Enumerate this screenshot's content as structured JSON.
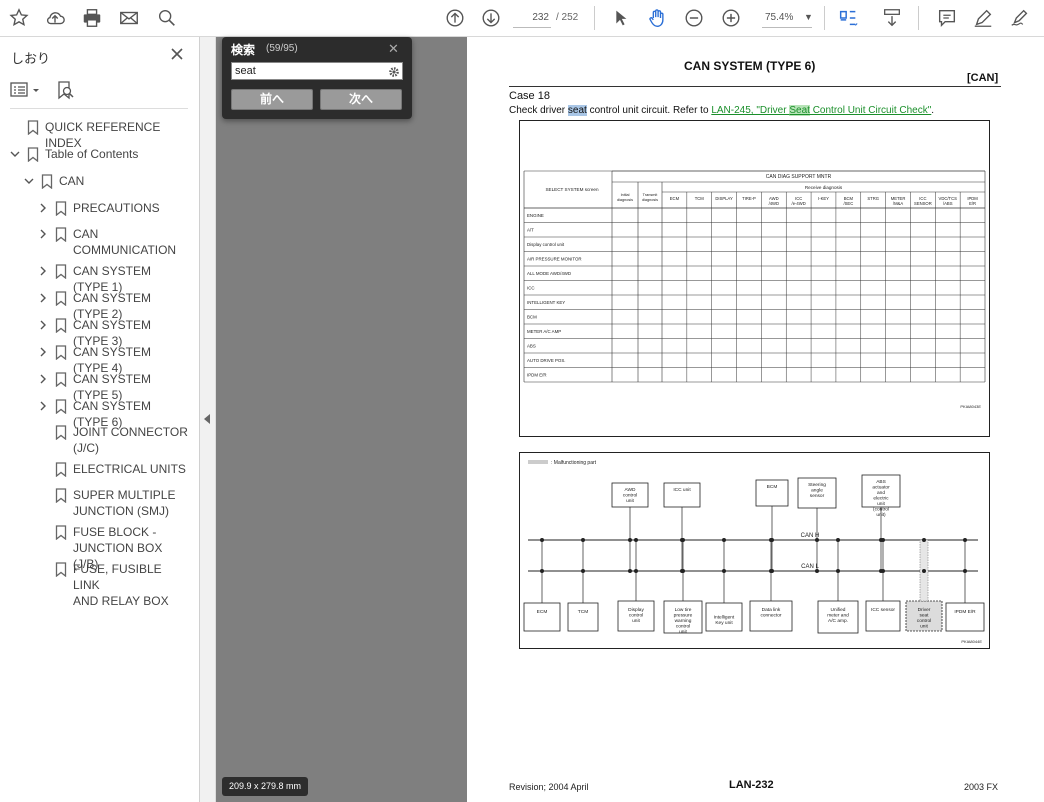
{
  "toolbar": {
    "page_current": "232",
    "page_total": "/ 252",
    "zoom": "75.4%",
    "icons": [
      "star-icon",
      "upload-icon",
      "print-icon",
      "mail-icon",
      "search-icon",
      "arrow-up-circle-icon",
      "arrow-down-circle-icon",
      "pointer-icon",
      "hand-icon",
      "zoom-out-icon",
      "zoom-in-icon",
      "fit-page-icon",
      "scroll-mode-icon",
      "comment-icon",
      "pen-icon",
      "sign-icon"
    ]
  },
  "sidebar": {
    "title": "しおり",
    "items": [
      {
        "label": "QUICK REFERENCE INDEX",
        "level": 0,
        "expander": "none"
      },
      {
        "label": "Table of Contents",
        "level": 0,
        "expander": "expanded"
      },
      {
        "label": "CAN",
        "level": 1,
        "expander": "expanded"
      },
      {
        "label": "PRECAUTIONS",
        "level": 2,
        "expander": "collapsed"
      },
      {
        "label": "CAN\nCOMMUNICATION",
        "level": 2,
        "expander": "collapsed"
      },
      {
        "label": "CAN SYSTEM (TYPE 1)",
        "level": 2,
        "expander": "collapsed"
      },
      {
        "label": "CAN SYSTEM (TYPE 2)",
        "level": 2,
        "expander": "collapsed"
      },
      {
        "label": "CAN SYSTEM (TYPE 3)",
        "level": 2,
        "expander": "collapsed"
      },
      {
        "label": "CAN SYSTEM (TYPE 4)",
        "level": 2,
        "expander": "collapsed"
      },
      {
        "label": "CAN SYSTEM (TYPE 5)",
        "level": 2,
        "expander": "collapsed"
      },
      {
        "label": "CAN SYSTEM (TYPE 6)",
        "level": 2,
        "expander": "collapsed"
      },
      {
        "label": "JOINT CONNECTOR\n(J/C)",
        "level": 2,
        "expander": "none"
      },
      {
        "label": "ELECTRICAL UNITS",
        "level": 2,
        "expander": "none"
      },
      {
        "label": "SUPER MULTIPLE\nJUNCTION (SMJ)",
        "level": 2,
        "expander": "none"
      },
      {
        "label": "FUSE BLOCK -\nJUNCTION BOX (J/B)",
        "level": 2,
        "expander": "none"
      },
      {
        "label": "FUSE, FUSIBLE LINK\nAND RELAY BOX",
        "level": 2,
        "expander": "none"
      }
    ]
  },
  "find": {
    "title": "検索",
    "count": "(59/95)",
    "query": "seat",
    "prev_label": "前へ",
    "next_label": "次へ"
  },
  "page": {
    "title": "CAN SYSTEM (TYPE 6)",
    "section": "[CAN]",
    "case": "Case 18",
    "check_pre": "Check driver ",
    "check_hl": "seat",
    "check_mid": " control unit circuit. Refer to ",
    "link_pre": "LAN-245, \"Driver ",
    "link_hl": "Seat",
    "link_post": " Control Unit Circuit Check\"",
    "check_end": ".",
    "footer_left": "Revision; 2004 April",
    "footer_center": "LAN-232",
    "footer_right": "2003 FX"
  },
  "figure_table": {
    "header": "CAN DIAG SUPPORT MNTR",
    "sub_header": "Receive diagnosis",
    "select_label": "SELECT SYSTEM screen",
    "col_initial": "Initial diagnosis",
    "col_transmit": "Transmit diagnosis",
    "receive_cols": [
      "ECM",
      "TCM",
      "DISPLAY",
      "TIRE-P",
      "AWD /4WD",
      "ICC /e-4WD",
      "I-KEY",
      "BCM /SEC",
      "STRG",
      "METER /M&A",
      "ICC SENSOR",
      "VDC/TCS /ABS",
      "IPDM E/R"
    ],
    "rows": [
      "ENGINE",
      "A/T",
      "Display control unit",
      "AIR PRESSURE MONITOR",
      "ALL MODE AWD/4WD",
      "ICC",
      "INTELLIGENT KEY",
      "BCM",
      "METER A/C AMP",
      "ABS",
      "AUTO DRIVE POS.",
      "IPDM E/R"
    ],
    "code": "PKIA8043E"
  },
  "figure_diagram": {
    "legend": "Malfunctioning part",
    "bus_h": "CAN H",
    "bus_l": "CAN L",
    "top_units": [
      "AWD control unit",
      "ICC unit",
      "BCM",
      "Steering angle sensor",
      "ABS actuator and electric unit (control unit)"
    ],
    "bottom_units": [
      "ECM",
      "TCM",
      "Display control unit",
      "Low tire pressure warning control unit",
      "Intelligent Key unit",
      "Data link connector",
      "Unified meter and A/C amp.",
      "ICC sensor",
      "Driver seat control unit",
      "IPDM E/R"
    ],
    "code": "PKIA8044E"
  },
  "status": {
    "dimensions": "209.9 x 279.8 mm"
  }
}
